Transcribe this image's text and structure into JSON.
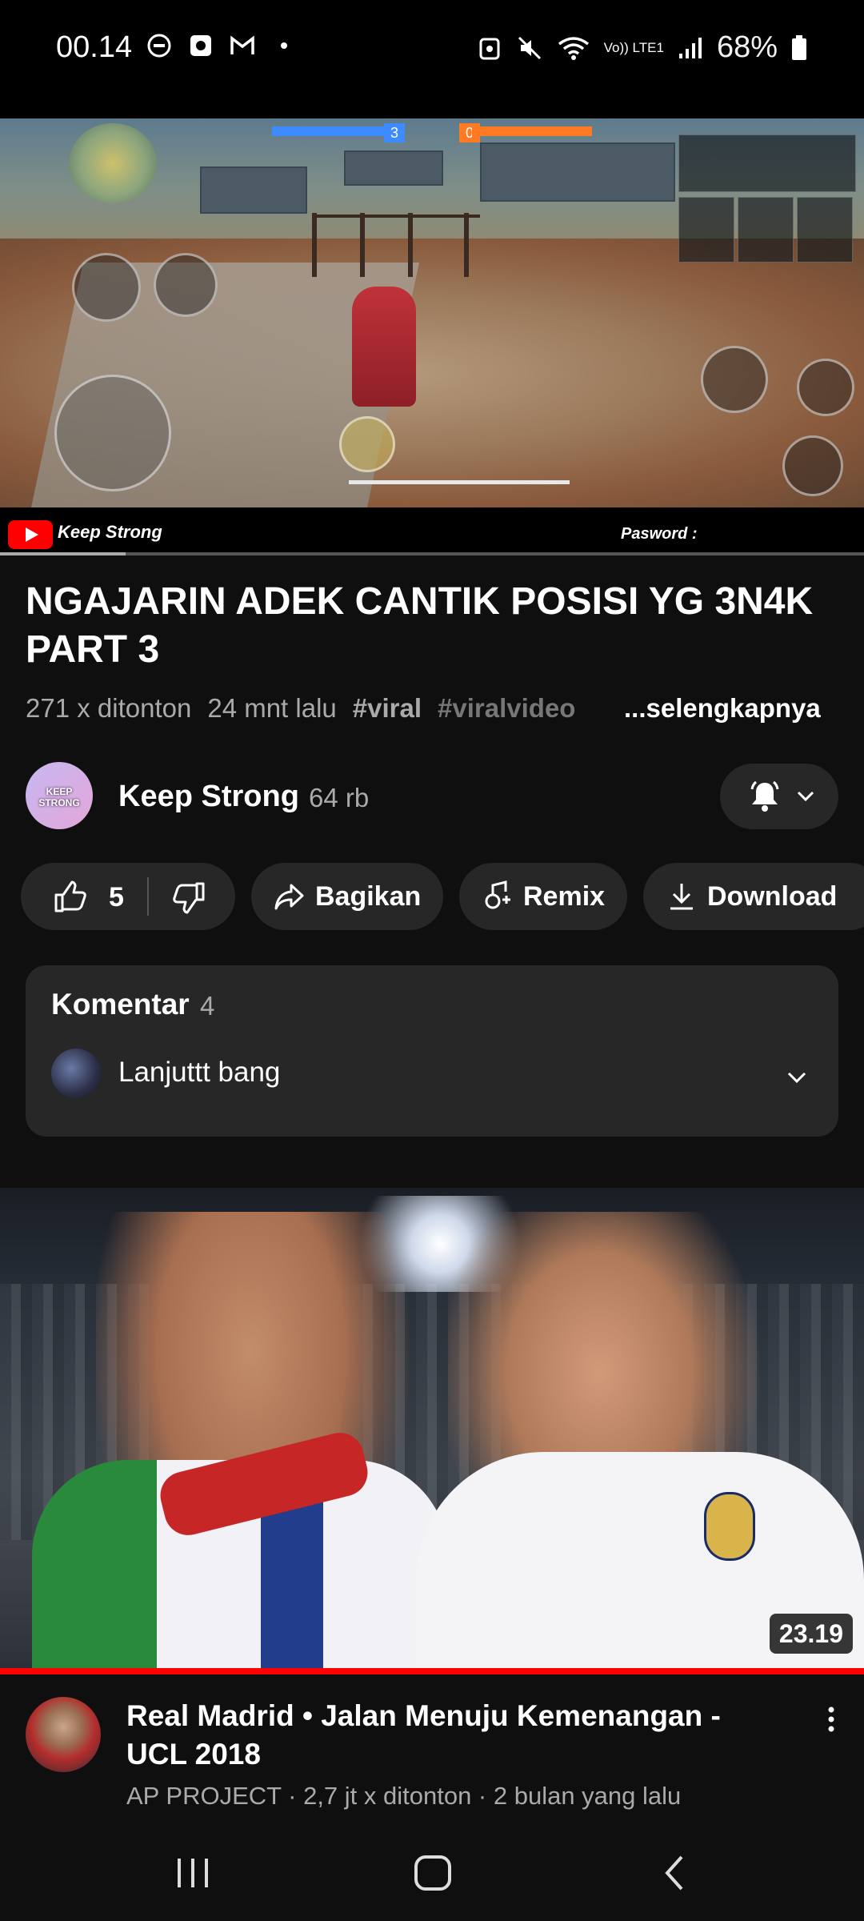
{
  "status_bar": {
    "time": "00.14",
    "battery": "68%",
    "network_label": "Vo)) LTE1"
  },
  "player": {
    "watermark_channel": "Keep Strong",
    "watermark_password": "Pasword :",
    "progress": 0.145
  },
  "video": {
    "title": "NGAJARIN ADEK CANTIK POSISI YG 3N4K PART 3",
    "views": "271 x ditonton",
    "time_ago": "24 mnt lalu",
    "tags": [
      "#viral",
      "#viralvideo"
    ],
    "more": "...selengkapnya"
  },
  "channel": {
    "name": "Keep Strong",
    "subscribers": "64 rb",
    "avatar_text": "KEEP STRONG"
  },
  "actions": {
    "likes": "5",
    "share": "Bagikan",
    "remix": "Remix",
    "download": "Download"
  },
  "comments": {
    "title": "Komentar",
    "count": "4",
    "top_comment": "Lanjuttt bang"
  },
  "recommended": {
    "duration": "23.19",
    "title": "Real Madrid • Jalan Menuju Kemenangan - UCL 2018",
    "meta": "AP PROJECT · 2,7 jt x ditonton · 2 bulan yang lalu"
  },
  "colors": {
    "background": "#0f0f0f",
    "surface": "#272727",
    "accent": "#ff0000"
  }
}
